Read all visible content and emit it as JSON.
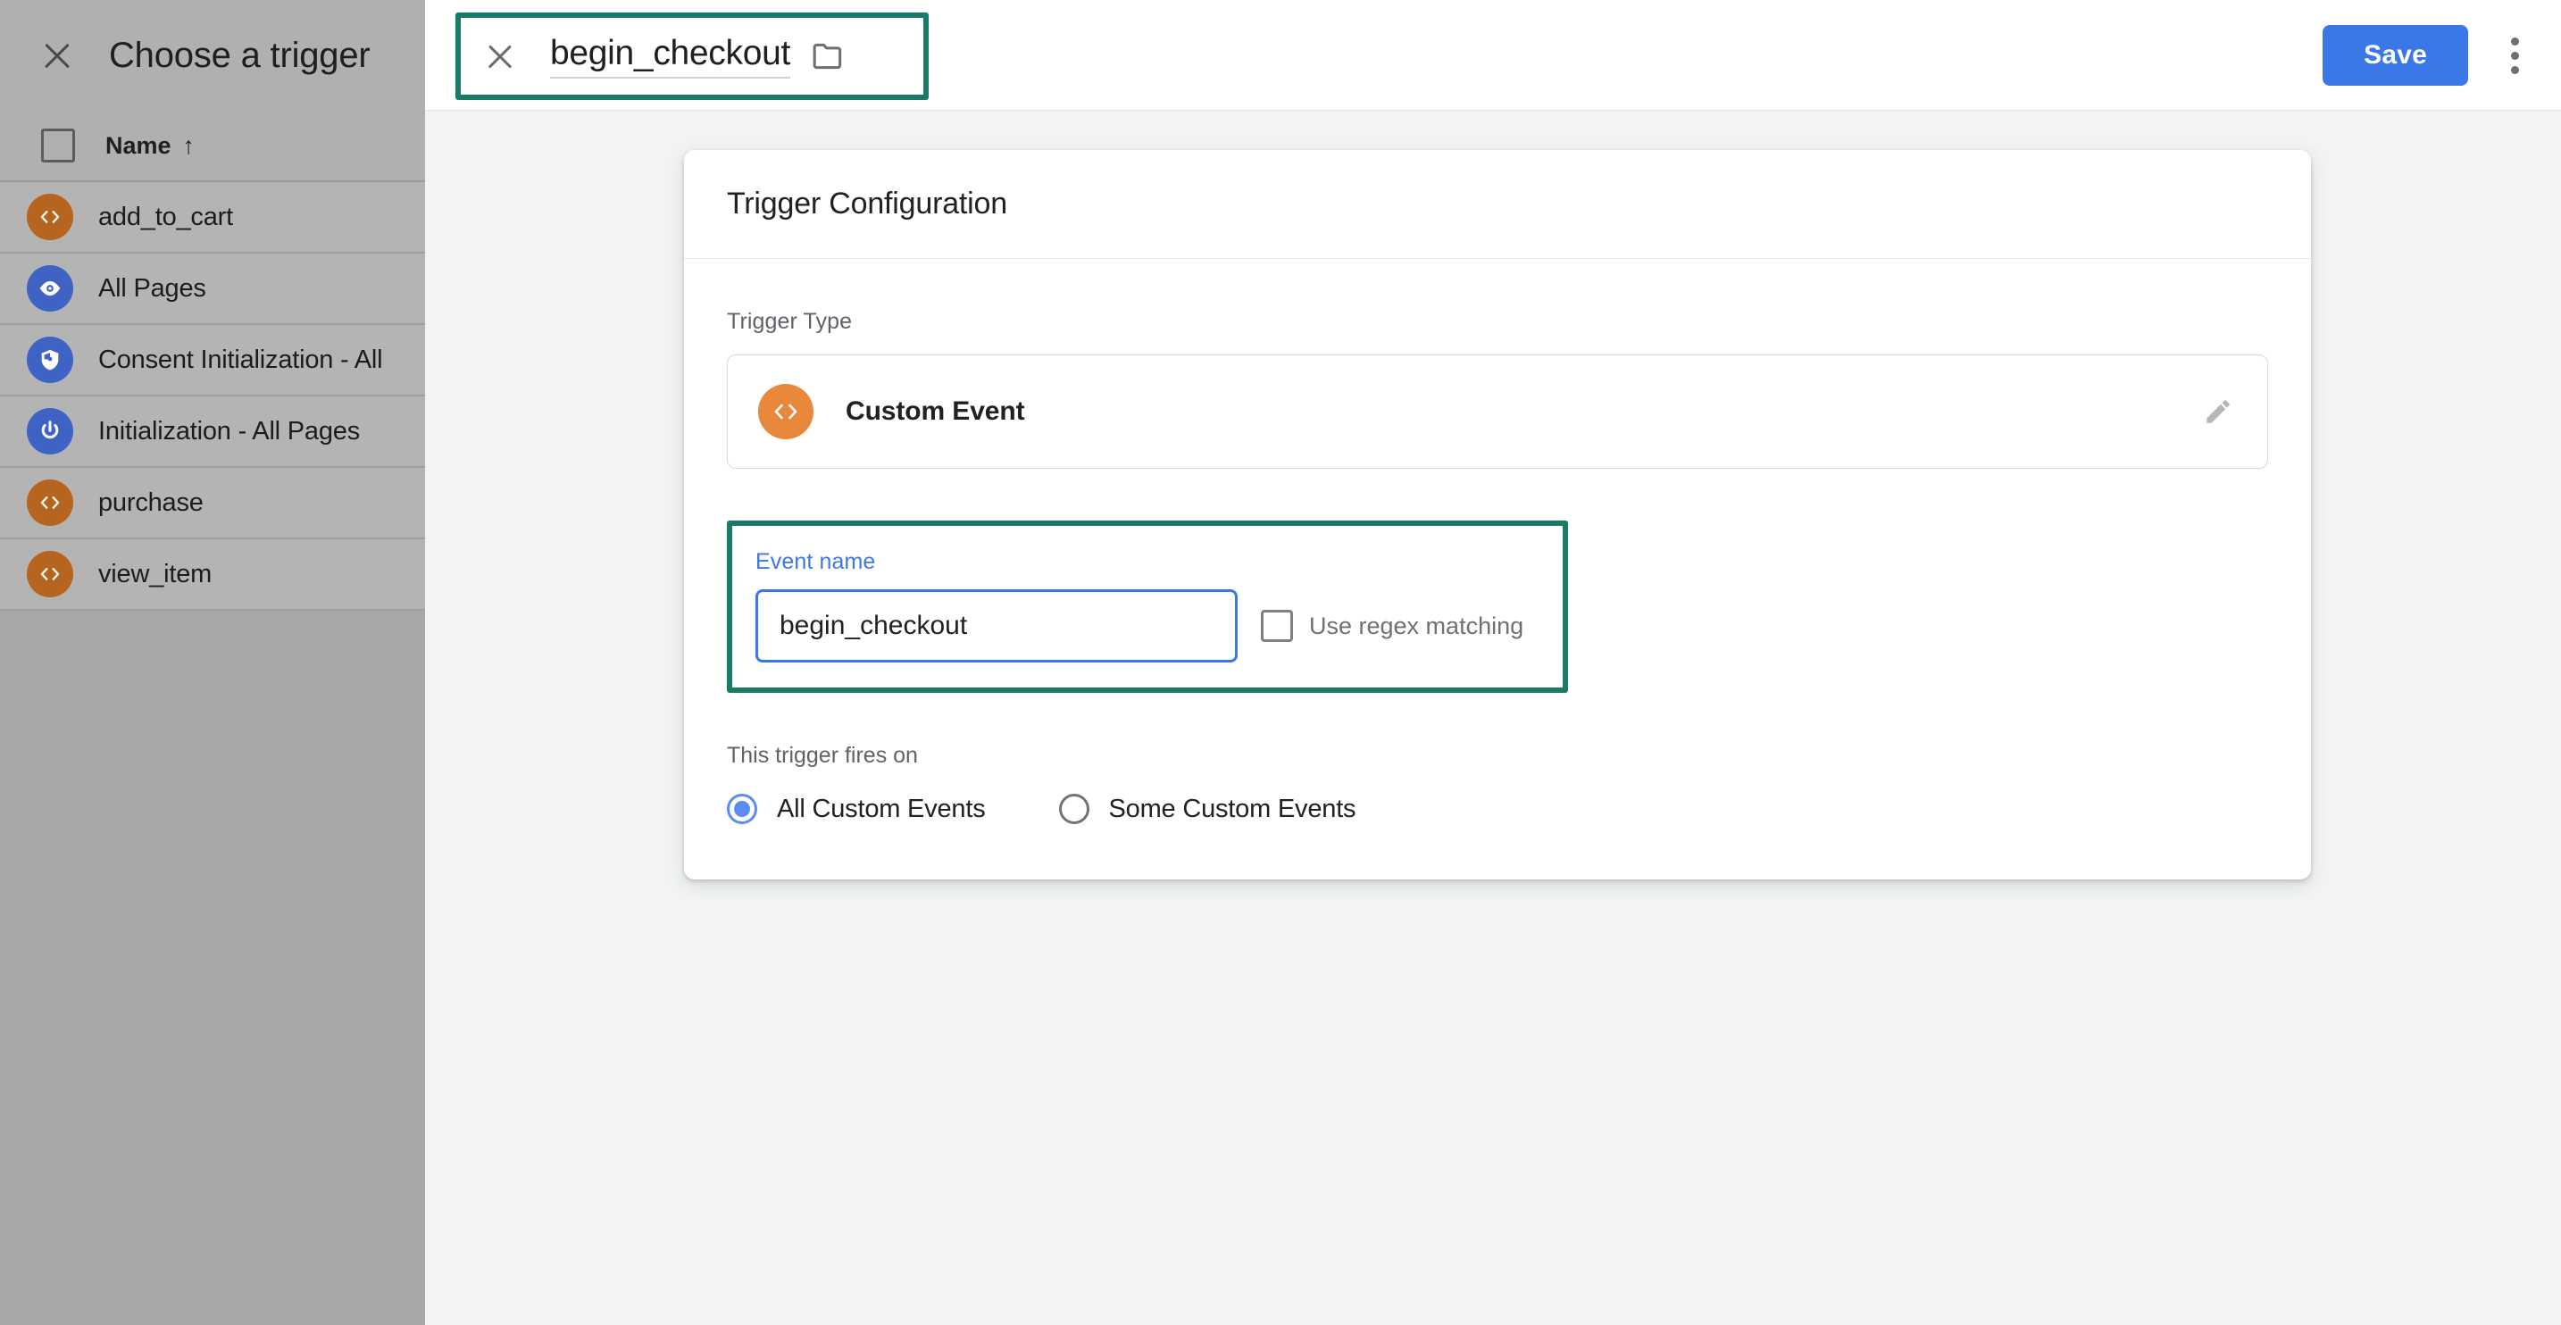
{
  "sidebar": {
    "title": "Choose a trigger",
    "close_icon": "close-icon",
    "column_header": "Name",
    "sort_arrow": "↑",
    "rows": [
      {
        "label": "add_to_cart",
        "icon": "code-icon",
        "icon_color": "#b5651d"
      },
      {
        "label": "All Pages",
        "icon": "eye-icon",
        "icon_color": "#3f63c4"
      },
      {
        "label": "Consent Initialization - All",
        "icon": "shield-icon",
        "icon_color": "#3f63c4"
      },
      {
        "label": "Initialization - All Pages",
        "icon": "power-icon",
        "icon_color": "#3f63c4"
      },
      {
        "label": "purchase",
        "icon": "code-icon",
        "icon_color": "#b5651d"
      },
      {
        "label": "view_item",
        "icon": "code-icon",
        "icon_color": "#b5651d"
      }
    ]
  },
  "topbar": {
    "close_icon": "close-icon",
    "trigger_name": "begin_checkout",
    "folder_icon": "folder-icon",
    "save_label": "Save",
    "more_icon": "more-vert-icon",
    "save_color": "#3b78e7",
    "highlight_color": "#1a7a68"
  },
  "card": {
    "title": "Trigger Configuration",
    "trigger_type_label": "Trigger Type",
    "trigger_type_value": "Custom Event",
    "trigger_type_icon": "code-icon",
    "trigger_type_icon_color": "#e8883a",
    "edit_icon": "pencil-icon",
    "event_name": {
      "label": "Event name",
      "value": "begin_checkout",
      "placeholder": "",
      "regex_label": "Use regex matching",
      "regex_checked": false,
      "label_color": "#3b78e7",
      "input_border_color": "#3b78e7",
      "highlight_color": "#1a7a68"
    },
    "fires_on": {
      "label": "This trigger fires on",
      "options": [
        {
          "label": "All Custom Events",
          "selected": true
        },
        {
          "label": "Some Custom Events",
          "selected": false
        }
      ],
      "selected_color": "#5b8def"
    }
  }
}
